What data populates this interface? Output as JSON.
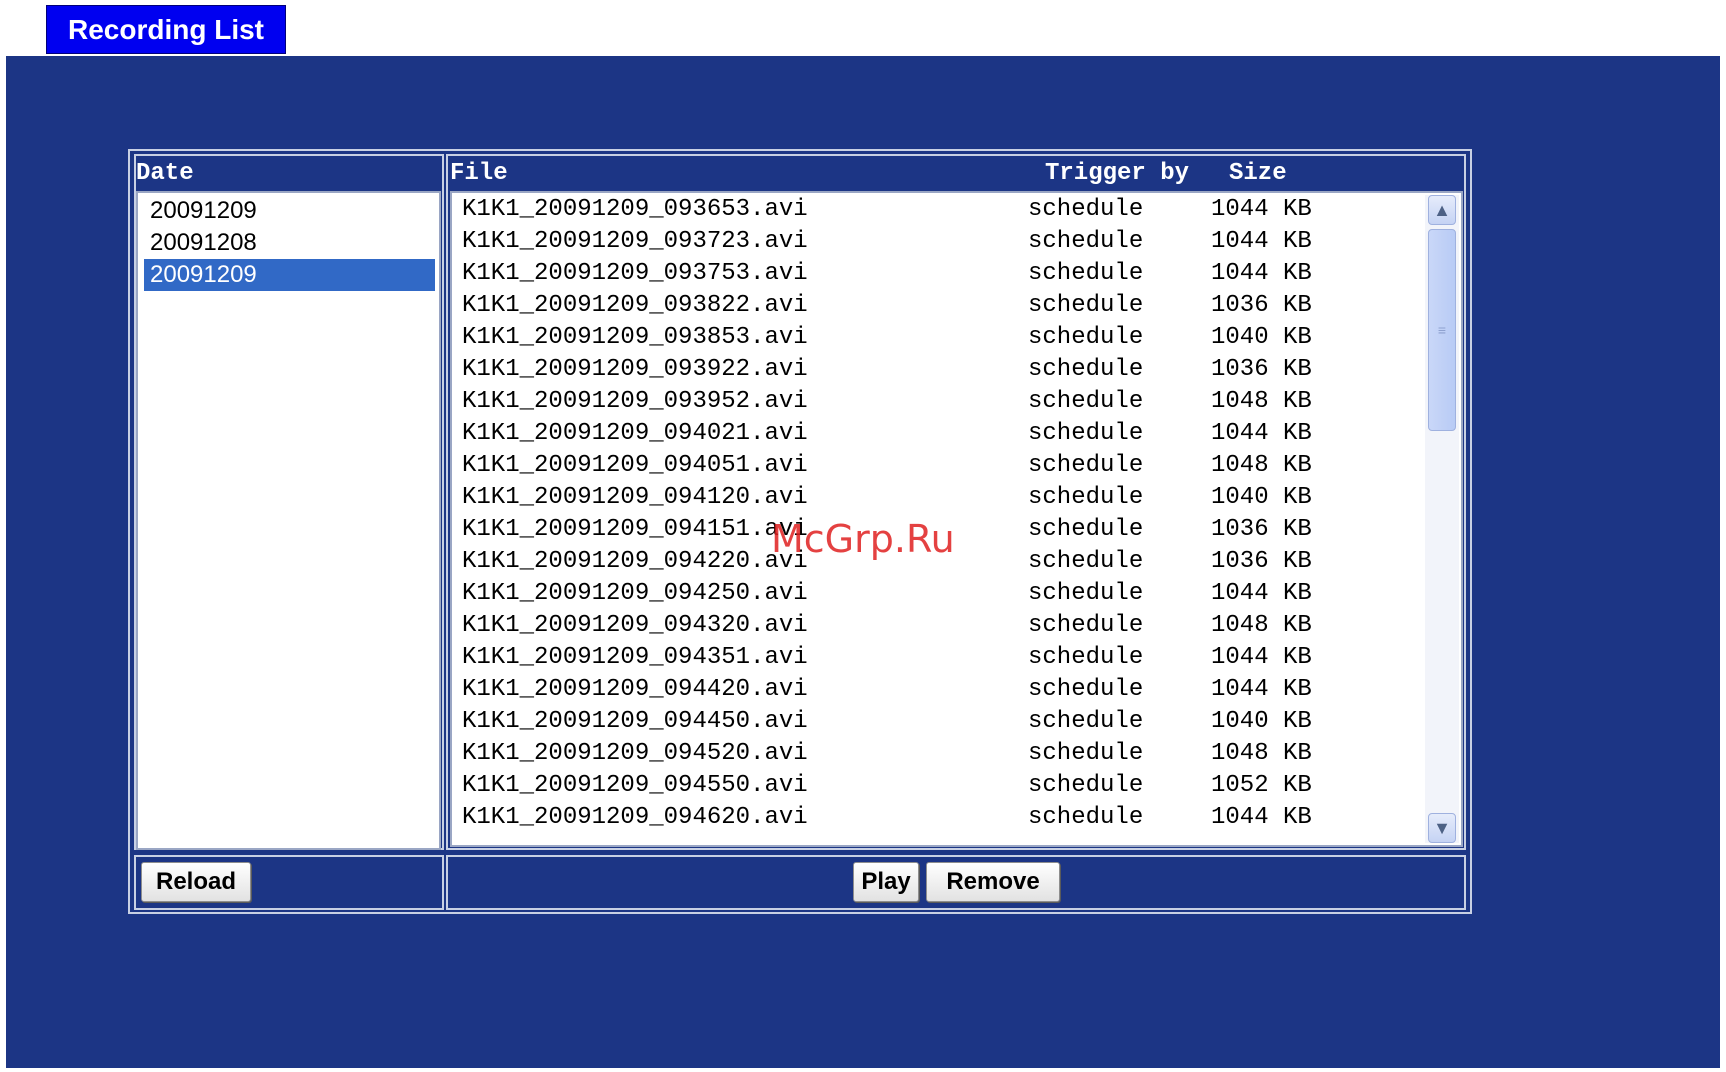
{
  "title": "Recording List",
  "columns": {
    "date": "Date",
    "file": "File",
    "trigger": "Trigger by",
    "size": "Size"
  },
  "dates": [
    {
      "label": "20091209",
      "selected": false
    },
    {
      "label": "20091208",
      "selected": false
    },
    {
      "label": "20091209",
      "selected": true
    }
  ],
  "files": [
    {
      "name": "K1K1_20091209_093653.avi",
      "trigger": "schedule",
      "size": "1044 KB"
    },
    {
      "name": "K1K1_20091209_093723.avi",
      "trigger": "schedule",
      "size": "1044 KB"
    },
    {
      "name": "K1K1_20091209_093753.avi",
      "trigger": "schedule",
      "size": "1044 KB"
    },
    {
      "name": "K1K1_20091209_093822.avi",
      "trigger": "schedule",
      "size": "1036 KB"
    },
    {
      "name": "K1K1_20091209_093853.avi",
      "trigger": "schedule",
      "size": "1040 KB"
    },
    {
      "name": "K1K1_20091209_093922.avi",
      "trigger": "schedule",
      "size": "1036 KB"
    },
    {
      "name": "K1K1_20091209_093952.avi",
      "trigger": "schedule",
      "size": "1048 KB"
    },
    {
      "name": "K1K1_20091209_094021.avi",
      "trigger": "schedule",
      "size": "1044 KB"
    },
    {
      "name": "K1K1_20091209_094051.avi",
      "trigger": "schedule",
      "size": "1048 KB"
    },
    {
      "name": "K1K1_20091209_094120.avi",
      "trigger": "schedule",
      "size": "1040 KB"
    },
    {
      "name": "K1K1_20091209_094151.avi",
      "trigger": "schedule",
      "size": "1036 KB"
    },
    {
      "name": "K1K1_20091209_094220.avi",
      "trigger": "schedule",
      "size": "1036 KB"
    },
    {
      "name": "K1K1_20091209_094250.avi",
      "trigger": "schedule",
      "size": "1044 KB"
    },
    {
      "name": "K1K1_20091209_094320.avi",
      "trigger": "schedule",
      "size": "1048 KB"
    },
    {
      "name": "K1K1_20091209_094351.avi",
      "trigger": "schedule",
      "size": "1044 KB"
    },
    {
      "name": "K1K1_20091209_094420.avi",
      "trigger": "schedule",
      "size": "1044 KB"
    },
    {
      "name": "K1K1_20091209_094450.avi",
      "trigger": "schedule",
      "size": "1040 KB"
    },
    {
      "name": "K1K1_20091209_094520.avi",
      "trigger": "schedule",
      "size": "1048 KB"
    },
    {
      "name": "K1K1_20091209_094550.avi",
      "trigger": "schedule",
      "size": "1052 KB"
    },
    {
      "name": "K1K1_20091209_094620.avi",
      "trigger": "schedule",
      "size": "1044 KB"
    }
  ],
  "buttons": {
    "reload": "Reload",
    "play": "Play",
    "remove": "Remove"
  },
  "scrollbar": {
    "up_icon": "chevron-up-icon",
    "down_icon": "chevron-down-icon",
    "up_glyph": "▲",
    "down_glyph": "▼",
    "grip_glyph": "≡"
  },
  "watermark": "McGrp.Ru",
  "colors": {
    "panel_bg": "#1c3585",
    "title_bg": "#0000f0",
    "selection": "#3169c6"
  }
}
